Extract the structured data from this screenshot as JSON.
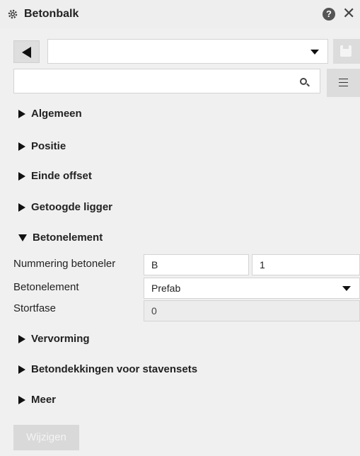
{
  "window": {
    "title": "Betonbalk",
    "icons": {
      "title": "gear-icon",
      "help": "help-icon",
      "close": "close-icon"
    }
  },
  "toolbar": {
    "preset_value": "",
    "search_value": "",
    "icons": {
      "back": "back-arrow-icon",
      "save": "save-icon",
      "search": "search-icon",
      "menu": "menu-icon"
    }
  },
  "sections": {
    "algemeen": "Algemeen",
    "positie": "Positie",
    "einde_offset": "Einde offset",
    "getoogde_ligger": "Getoogde ligger",
    "betonelement": "Betonelement",
    "vervorming": "Vervorming",
    "betondekkingen": "Betondekkingen voor stavensets",
    "meer": "Meer"
  },
  "betonelement": {
    "nummering_label": "Nummering betoneler",
    "nummering_prefix": "B",
    "nummering_start": "1",
    "element_label": "Betonelement",
    "element_value": "Prefab",
    "stortfase_label": "Stortfase",
    "stortfase_value": "0"
  },
  "footer": {
    "apply_label": "Wijzigen"
  },
  "colors": {
    "background": "#f0f0f0",
    "button_disabled": "#d9d9d9",
    "input_border": "#d4d4d4"
  }
}
